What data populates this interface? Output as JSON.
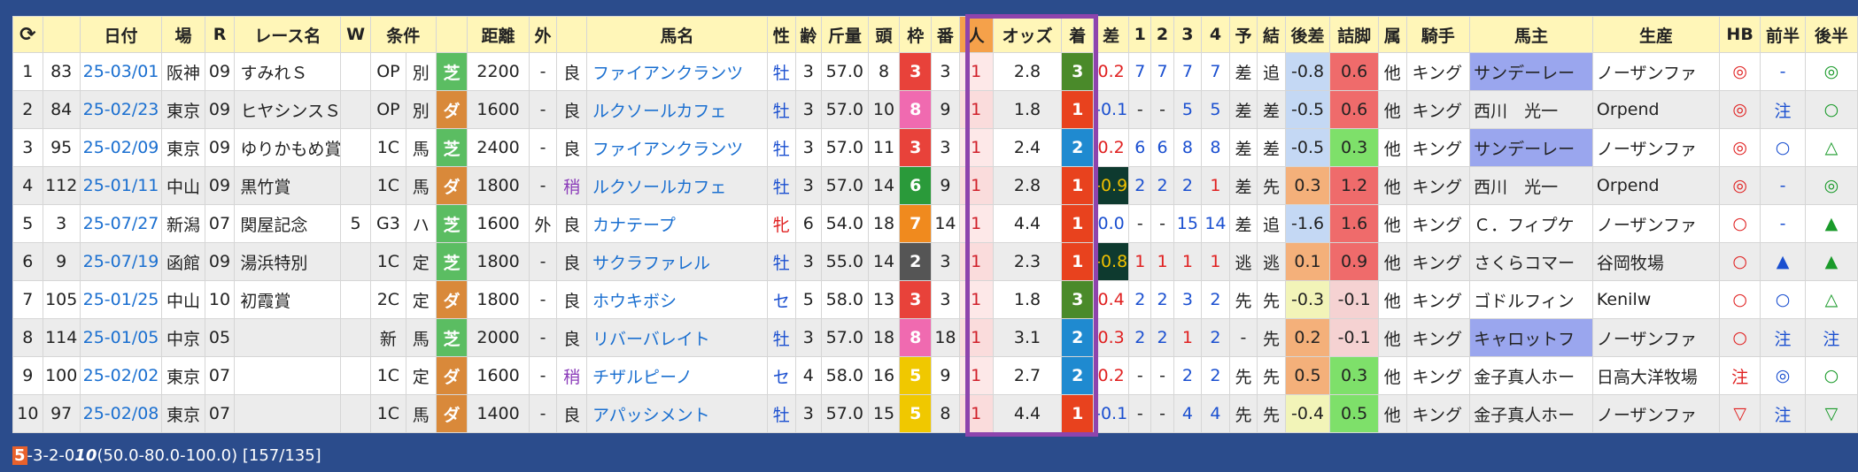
{
  "header": {
    "refresh_icon": "⟳",
    "cols": [
      "日付",
      "場",
      "R",
      "レース名",
      "W",
      "条件",
      "",
      "",
      "距離",
      "外",
      "",
      "馬名",
      "性",
      "齢",
      "斤量",
      "頭",
      "枠",
      "番",
      "人",
      "オッズ",
      "着",
      "差",
      "1",
      "2",
      "3",
      "4",
      "予",
      "結",
      "後差",
      "詰脚",
      "属",
      "騎手",
      "馬主",
      "生産",
      "HB",
      "前半",
      "後半"
    ]
  },
  "rows": [
    {
      "n": "1",
      "id": "83",
      "date": "25-03/01",
      "place": "阪神",
      "r": "09",
      "race": "すみれＳ",
      "w": "",
      "cls": "OP",
      "cond": "別",
      "track": "芝",
      "dist": "2200",
      "out": "-",
      "grd": "良",
      "horse": "ファイアンクランツ",
      "sex": "牡",
      "age": "3",
      "kin": "57.0",
      "tou": "8",
      "waku": "3",
      "ban": "3",
      "pop": "1",
      "odds": "2.8",
      "fin": "3",
      "diff": "0.2",
      "c1": "7",
      "c2": "7",
      "c3": "7",
      "c4": "7",
      "yo": "差",
      "ke": "追",
      "ato": "-0.8",
      "tsume": "0.6",
      "zoku": "他",
      "jockey": "キング",
      "owner": "サンデーレー",
      "breeder": "ノーザンファ",
      "hb": "◎",
      "zen": "-",
      "kou": "◎"
    },
    {
      "n": "2",
      "id": "84",
      "date": "25-02/23",
      "place": "東京",
      "r": "09",
      "race": "ヒヤシンスＳ",
      "w": "",
      "cls": "OP",
      "cond": "別",
      "track": "ダ",
      "dist": "1600",
      "out": "-",
      "grd": "良",
      "horse": "ルクソールカフェ",
      "sex": "牡",
      "age": "3",
      "kin": "57.0",
      "tou": "10",
      "waku": "8",
      "ban": "9",
      "pop": "1",
      "odds": "1.8",
      "fin": "1",
      "diff": "-0.1",
      "c1": "-",
      "c2": "-",
      "c3": "5",
      "c4": "5",
      "yo": "差",
      "ke": "差",
      "ato": "-0.5",
      "tsume": "0.6",
      "zoku": "他",
      "jockey": "キング",
      "owner": "西川　光一",
      "breeder": "Orpend",
      "hb": "◎",
      "zen": "注",
      "kou": "○"
    },
    {
      "n": "3",
      "id": "95",
      "date": "25-02/09",
      "place": "東京",
      "r": "09",
      "race": "ゆりかもめ賞",
      "w": "",
      "cls": "1C",
      "cond": "馬",
      "track": "芝",
      "dist": "2400",
      "out": "-",
      "grd": "良",
      "horse": "ファイアンクランツ",
      "sex": "牡",
      "age": "3",
      "kin": "57.0",
      "tou": "11",
      "waku": "3",
      "ban": "3",
      "pop": "1",
      "odds": "2.4",
      "fin": "2",
      "diff": "0.2",
      "c1": "6",
      "c2": "6",
      "c3": "8",
      "c4": "8",
      "yo": "差",
      "ke": "差",
      "ato": "-0.5",
      "tsume": "0.3",
      "zoku": "他",
      "jockey": "キング",
      "owner": "サンデーレー",
      "breeder": "ノーザンファ",
      "hb": "◎",
      "zen": "○",
      "kou": "△"
    },
    {
      "n": "4",
      "id": "112",
      "date": "25-01/11",
      "place": "中山",
      "r": "09",
      "race": "黒竹賞",
      "w": "",
      "cls": "1C",
      "cond": "馬",
      "track": "ダ",
      "dist": "1800",
      "out": "-",
      "grd": "稍",
      "horse": "ルクソールカフェ",
      "sex": "牡",
      "age": "3",
      "kin": "57.0",
      "tou": "14",
      "waku": "6",
      "ban": "9",
      "pop": "1",
      "odds": "2.8",
      "fin": "1",
      "diff": "-0.9",
      "c1": "2",
      "c2": "2",
      "c3": "2",
      "c4": "1",
      "yo": "差",
      "ke": "先",
      "ato": "0.3",
      "tsume": "1.2",
      "zoku": "他",
      "jockey": "キング",
      "owner": "西川　光一",
      "breeder": "Orpend",
      "hb": "◎",
      "zen": "-",
      "kou": "◎"
    },
    {
      "n": "5",
      "id": "3",
      "date": "25-07/27",
      "place": "新潟",
      "r": "07",
      "race": "関屋記念",
      "w": "5",
      "cls": "G3",
      "cond": "ハ",
      "track": "芝",
      "dist": "1600",
      "out": "外",
      "grd": "良",
      "horse": "カナテープ",
      "sex": "牝",
      "age": "6",
      "kin": "54.0",
      "tou": "18",
      "waku": "7",
      "ban": "14",
      "pop": "1",
      "odds": "4.4",
      "fin": "1",
      "diff": "0.0",
      "c1": "-",
      "c2": "-",
      "c3": "15",
      "c4": "14",
      "yo": "差",
      "ke": "追",
      "ato": "-1.6",
      "tsume": "1.6",
      "zoku": "他",
      "jockey": "キング",
      "owner": "Ｃ．フィプケ",
      "breeder": "ノーザンファ",
      "hb": "○",
      "zen": "-",
      "kou": "▲"
    },
    {
      "n": "6",
      "id": "9",
      "date": "25-07/19",
      "place": "函館",
      "r": "09",
      "race": "湯浜特別",
      "w": "",
      "cls": "1C",
      "cond": "定",
      "track": "芝",
      "dist": "1800",
      "out": "-",
      "grd": "良",
      "horse": "サクラファレル",
      "sex": "牡",
      "age": "3",
      "kin": "55.0",
      "tou": "14",
      "waku": "2",
      "ban": "3",
      "pop": "1",
      "odds": "2.3",
      "fin": "1",
      "diff": "-0.8",
      "c1": "1",
      "c2": "1",
      "c3": "1",
      "c4": "1",
      "yo": "逃",
      "ke": "逃",
      "ato": "0.1",
      "tsume": "0.9",
      "zoku": "他",
      "jockey": "キング",
      "owner": "さくらコマー",
      "breeder": "谷岡牧場",
      "hb": "○",
      "zen": "▲",
      "kou": "▲"
    },
    {
      "n": "7",
      "id": "105",
      "date": "25-01/25",
      "place": "中山",
      "r": "10",
      "race": "初霞賞",
      "w": "",
      "cls": "2C",
      "cond": "定",
      "track": "ダ",
      "dist": "1800",
      "out": "-",
      "grd": "良",
      "horse": "ホウキボシ",
      "sex": "セ",
      "age": "5",
      "kin": "58.0",
      "tou": "13",
      "waku": "3",
      "ban": "3",
      "pop": "1",
      "odds": "1.8",
      "fin": "3",
      "diff": "0.4",
      "c1": "2",
      "c2": "2",
      "c3": "3",
      "c4": "2",
      "yo": "先",
      "ke": "先",
      "ato": "-0.3",
      "tsume": "-0.1",
      "zoku": "他",
      "jockey": "キング",
      "owner": "ゴドルフィン",
      "breeder": "Kenilw",
      "hb": "○",
      "zen": "○",
      "kou": "△"
    },
    {
      "n": "8",
      "id": "114",
      "date": "25-01/05",
      "place": "中京",
      "r": "05",
      "race": "",
      "w": "",
      "cls": "新",
      "cond": "馬",
      "track": "芝",
      "dist": "2000",
      "out": "-",
      "grd": "良",
      "horse": "リバーバレイト",
      "sex": "牡",
      "age": "3",
      "kin": "57.0",
      "tou": "18",
      "waku": "8",
      "ban": "18",
      "pop": "1",
      "odds": "3.1",
      "fin": "2",
      "diff": "0.3",
      "c1": "2",
      "c2": "2",
      "c3": "1",
      "c4": "2",
      "yo": "-",
      "ke": "先",
      "ato": "0.2",
      "tsume": "-0.1",
      "zoku": "他",
      "jockey": "キング",
      "owner": "キャロットフ",
      "breeder": "ノーザンファ",
      "hb": "○",
      "zen": "注",
      "kou": "注"
    },
    {
      "n": "9",
      "id": "100",
      "date": "25-02/02",
      "place": "東京",
      "r": "07",
      "race": "",
      "w": "",
      "cls": "1C",
      "cond": "定",
      "track": "ダ",
      "dist": "1600",
      "out": "-",
      "grd": "稍",
      "horse": "チザルピーノ",
      "sex": "セ",
      "age": "4",
      "kin": "58.0",
      "tou": "16",
      "waku": "5",
      "ban": "9",
      "pop": "1",
      "odds": "2.7",
      "fin": "2",
      "diff": "0.2",
      "c1": "-",
      "c2": "-",
      "c3": "2",
      "c4": "2",
      "yo": "先",
      "ke": "先",
      "ato": "0.5",
      "tsume": "0.3",
      "zoku": "他",
      "jockey": "キング",
      "owner": "金子真人ホー",
      "breeder": "日高大洋牧場",
      "hb": "注",
      "zen": "◎",
      "kou": "○"
    },
    {
      "n": "10",
      "id": "97",
      "date": "25-02/08",
      "place": "東京",
      "r": "07",
      "race": "",
      "w": "",
      "cls": "1C",
      "cond": "馬",
      "track": "ダ",
      "dist": "1400",
      "out": "-",
      "grd": "良",
      "horse": "アパッシメント",
      "sex": "牡",
      "age": "3",
      "kin": "57.0",
      "tou": "15",
      "waku": "5",
      "ban": "8",
      "pop": "1",
      "odds": "4.4",
      "fin": "1",
      "diff": "-0.1",
      "c1": "-",
      "c2": "-",
      "c3": "4",
      "c4": "4",
      "yo": "先",
      "ke": "先",
      "ato": "-0.4",
      "tsume": "0.5",
      "zoku": "他",
      "jockey": "キング",
      "owner": "金子真人ホー",
      "breeder": "ノーザンファ",
      "hb": "▽",
      "zen": "注",
      "kou": "▽"
    }
  ],
  "footer": {
    "wins": "5",
    "rest": "-3-2-0 ",
    "total": "10",
    "rates": " (50.0-80.0-100.0) [157/135]"
  },
  "colors": {
    "waku": {
      "2": "#555555",
      "3": "#e8423a",
      "5": "#f0c800",
      "6": "#2a9a3a",
      "7": "#f08a1e",
      "8": "#f06ab0"
    },
    "fin": {
      "1": "#e8421e",
      "2": "#1f8ad0",
      "3": "#4a8a2a"
    }
  }
}
